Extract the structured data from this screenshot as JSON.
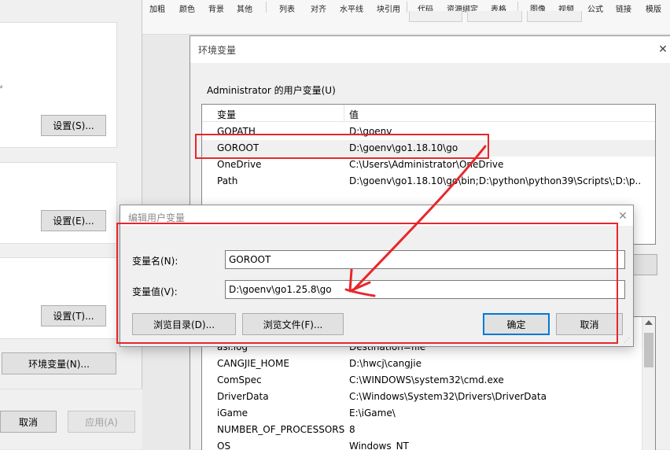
{
  "toolbar": {
    "items": [
      "加粗",
      "颜色",
      "背景",
      "其他",
      "列表",
      "对齐",
      "水平线",
      "块引用",
      "代码",
      "资源绑定",
      "表格",
      "图像",
      "视频",
      "公式",
      "链接",
      "模版"
    ]
  },
  "system_properties": {
    "settings_s_label": "设置(S)...",
    "settings_e_label": "设置(E)...",
    "settings_t_label": "设置(T)...",
    "env_vars_label": "环境变量(N)...",
    "cancel_label": "取消",
    "apply_label": "应用(A)"
  },
  "env_dialog": {
    "title": "环境变量",
    "user_group_label": "Administrator 的用户变量(U)",
    "col_variable": "变量",
    "col_value": "值",
    "user_vars": [
      {
        "name": "GOPATH",
        "value": "D:\\goenv"
      },
      {
        "name": "GOROOT",
        "value": "D:\\goenv\\go1.18.10\\go"
      },
      {
        "name": "OneDrive",
        "value": "C:\\Users\\Administrator\\OneDrive"
      },
      {
        "name": "Path",
        "value": "D:\\goenv\\go1.18.10\\go\\bin;D:\\python\\python39\\Scripts\\;D:\\p..."
      }
    ],
    "system_vars": [
      {
        "name": "asl.log",
        "value": "Destination=file"
      },
      {
        "name": "CANGJIE_HOME",
        "value": "D:\\hwcj\\cangjie"
      },
      {
        "name": "ComSpec",
        "value": "C:\\WINDOWS\\system32\\cmd.exe"
      },
      {
        "name": "DriverData",
        "value": "C:\\Windows\\System32\\Drivers\\DriverData"
      },
      {
        "name": "iGame",
        "value": "E:\\iGame\\"
      },
      {
        "name": "NUMBER_OF_PROCESSORS",
        "value": "8"
      },
      {
        "name": "OS",
        "value": "Windows_NT"
      }
    ]
  },
  "edit_dialog": {
    "title": "编辑用户变量",
    "name_label": "变量名(N):",
    "name_value": "GOROOT",
    "value_label": "变量值(V):",
    "value_value": "D:\\goenv\\go1.25.8\\go",
    "browse_dir_label": "浏览目录(D)...",
    "browse_file_label": "浏览文件(F)...",
    "ok_label": "确定",
    "cancel_label": "取消"
  },
  "annotation_color": "#e8262b",
  "icons": [
    "close-icon",
    "resize-grip-icon",
    "arrow-annotation"
  ]
}
